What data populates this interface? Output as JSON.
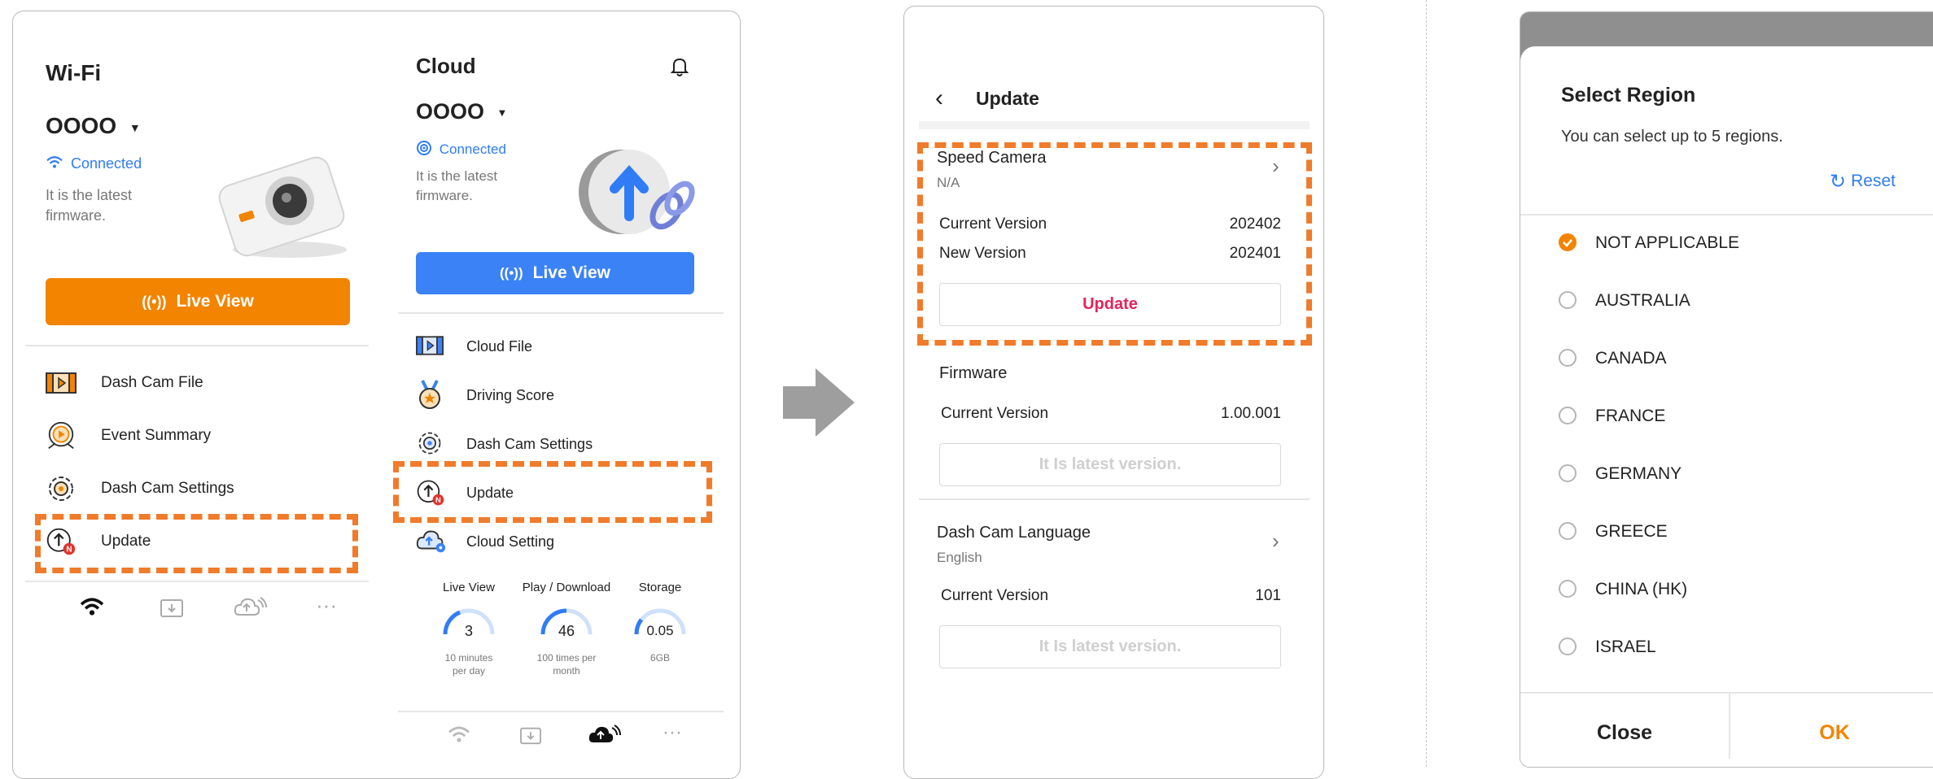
{
  "wifi": {
    "title": "Wi-Fi",
    "device_name": "OOOO",
    "status": "Connected",
    "firmware_msg_1": "It is the latest",
    "firmware_msg_2": "firmware.",
    "live_view": "Live View",
    "menu": [
      "Dash Cam File",
      "Event Summary",
      "Dash Cam Settings",
      "Update"
    ],
    "accent": "#f28400"
  },
  "cloud": {
    "title": "Cloud",
    "device_name": "OOOO",
    "status": "Connected",
    "firmware_msg_1": "It is the latest",
    "firmware_msg_2": "firmware.",
    "live_view": "Live View",
    "menu": [
      "Cloud File",
      "Driving Score",
      "Dash Cam Settings",
      "Update",
      "Cloud Setting"
    ],
    "stats": [
      {
        "label": "Live View",
        "value": "3",
        "sub1": "10 minutes",
        "sub2": "per day"
      },
      {
        "label": "Play / Download",
        "value": "46",
        "sub1": "100 times per",
        "sub2": "month"
      },
      {
        "label": "Storage",
        "value": "0.05",
        "sub1": "6GB",
        "sub2": ""
      }
    ],
    "accent": "#3b82f6"
  },
  "update": {
    "title": "Update",
    "speed_camera": {
      "name": "Speed Camera",
      "sub": "N/A",
      "current_label": "Current Version",
      "current_value": "202402",
      "new_label": "New Version",
      "new_value": "202401",
      "button": "Update"
    },
    "firmware": {
      "name": "Firmware",
      "current_label": "Current Version",
      "current_value": "1.00.001",
      "button": "It Is latest version."
    },
    "language": {
      "name": "Dash Cam Language",
      "sub": "English",
      "current_label": "Current Version",
      "current_value": "101",
      "button": "It Is latest version."
    }
  },
  "region": {
    "title": "Select Region",
    "subtitle": "You can select up to 5 regions.",
    "reset": "Reset",
    "options": [
      "NOT APPLICABLE",
      "AUSTRALIA",
      "CANADA",
      "FRANCE",
      "GERMANY",
      "GREECE",
      "CHINA (HK)",
      "ISRAEL"
    ],
    "selected_index": 0,
    "close": "Close",
    "ok": "OK"
  }
}
